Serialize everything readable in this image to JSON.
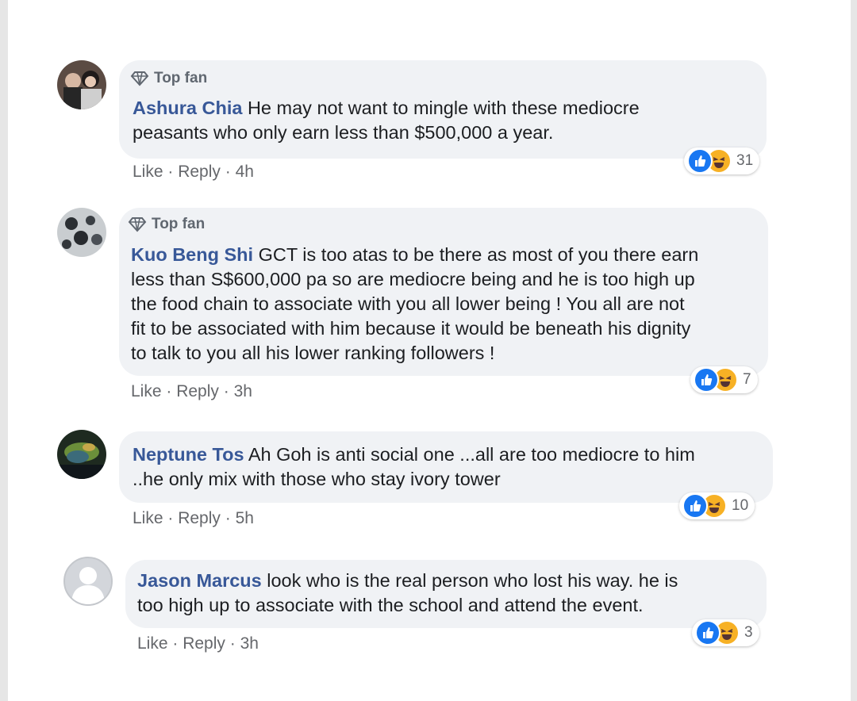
{
  "comments": [
    {
      "badge": "Top fan",
      "author": "Ashura Chia",
      "text_lines": [
        "He may not want to mingle with these mediocre",
        "peasants who only earn less than $500,000 a year."
      ],
      "like": "Like",
      "reply": "Reply",
      "time": "4h",
      "reactions": "31"
    },
    {
      "badge": "Top fan",
      "author": "Kuo Beng Shi",
      "text_lines": [
        "GCT is too atas to be there as most of you there earn",
        "less than S$600,000 pa so are mediocre being and he is too high up",
        "the food chain to associate with you all lower being ! You all are not",
        "fit to be associated with him because it would be beneath his dignity",
        "to talk to you all his lower ranking followers !"
      ],
      "like": "Like",
      "reply": "Reply",
      "time": "3h",
      "reactions": "7"
    },
    {
      "author": "Neptune Tos",
      "text_lines": [
        "Ah Goh is anti social one ...all are too mediocre to him",
        "..he only mix with those who stay ivory tower"
      ],
      "like": "Like",
      "reply": "Reply",
      "time": "5h",
      "reactions": "10"
    },
    {
      "author": "Jason Marcus",
      "text_lines": [
        "look who is the real person who lost his way. he is",
        "too high up to associate with the school and attend the event."
      ],
      "like": "Like",
      "reply": "Reply",
      "time": "3h",
      "reactions": "3"
    }
  ],
  "separator": " · ",
  "colors": {
    "author": "#385898",
    "bubble": "#f0f2f5",
    "like_reaction": "#1877f2",
    "haha_reaction": "#f7b125"
  },
  "icons": [
    "top-fan-diamond-icon",
    "like-reaction-icon",
    "haha-reaction-icon",
    "avatar-placeholder-icon"
  ]
}
